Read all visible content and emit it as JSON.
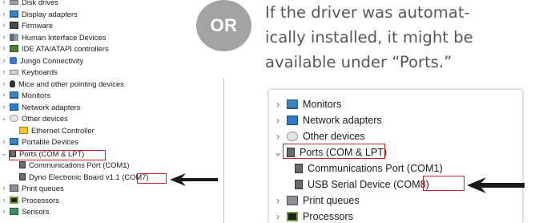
{
  "or_badge": {
    "label": "OR"
  },
  "instructions": {
    "line1": "If the driver was automat-",
    "line2": "ically installed, it might be",
    "line3": "available under “Ports.”"
  },
  "left_tree": {
    "items": [
      {
        "label": "Disk drives",
        "icon": "disk-drive-icon",
        "expanded": false
      },
      {
        "label": "Display adapters",
        "icon": "display-adapter-icon",
        "expanded": false
      },
      {
        "label": "Firmware",
        "icon": "firmware-icon",
        "expanded": false
      },
      {
        "label": "Human Interface Devices",
        "icon": "hid-icon",
        "expanded": false
      },
      {
        "label": "IDE ATA/ATAPI controllers",
        "icon": "ide-controller-icon",
        "expanded": false
      },
      {
        "label": "Jungo Connectivity",
        "icon": "usb-icon",
        "expanded": false
      },
      {
        "label": "Keyboards",
        "icon": "keyboard-icon",
        "expanded": false
      },
      {
        "label": "Mice and other pointing devices",
        "icon": "mouse-icon",
        "expanded": false
      },
      {
        "label": "Monitors",
        "icon": "monitor-icon",
        "expanded": false
      },
      {
        "label": "Network adapters",
        "icon": "network-adapter-icon",
        "expanded": false
      },
      {
        "label": "Other devices",
        "icon": "other-devices-icon",
        "expanded": true
      },
      {
        "label": "Ethernet Controller",
        "icon": "warning-device-icon",
        "child": true
      },
      {
        "label": "Portable Devices",
        "icon": "portable-devices-icon",
        "expanded": false
      },
      {
        "label": "Ports (COM & LPT)",
        "icon": "port-icon",
        "expanded": true
      },
      {
        "label": "Communications Port (COM1)",
        "icon": "port-icon",
        "child": true
      },
      {
        "label": "Dyno Electronic Board v1.1 (COM7)",
        "icon": "port-icon",
        "child": true
      },
      {
        "label": "Print queues",
        "icon": "printer-icon",
        "expanded": false
      },
      {
        "label": "Processors",
        "icon": "processor-icon",
        "expanded": false
      },
      {
        "label": "Sensors",
        "icon": "sensor-icon",
        "expanded": false
      }
    ]
  },
  "right_tree": {
    "items": [
      {
        "label": "Monitors",
        "icon": "monitor-icon",
        "expanded": false
      },
      {
        "label": "Network adapters",
        "icon": "network-adapter-icon",
        "expanded": false
      },
      {
        "label": "Other devices",
        "icon": "other-devices-icon",
        "expanded": false
      },
      {
        "label": "Ports (COM & LPT)",
        "icon": "port-icon",
        "expanded": true
      },
      {
        "label": "Communications Port (COM1)",
        "icon": "port-icon",
        "child": true
      },
      {
        "label": "USB Serial Device (COM8)",
        "icon": "port-icon",
        "child": true
      },
      {
        "label": "Print queues",
        "icon": "printer-icon",
        "expanded": false
      },
      {
        "label": "Processors",
        "icon": "processor-icon",
        "expanded": false
      }
    ]
  },
  "colors": {
    "highlight": "#d0202b",
    "badge": "#a3a3a3",
    "instruction_text": "#555759"
  }
}
